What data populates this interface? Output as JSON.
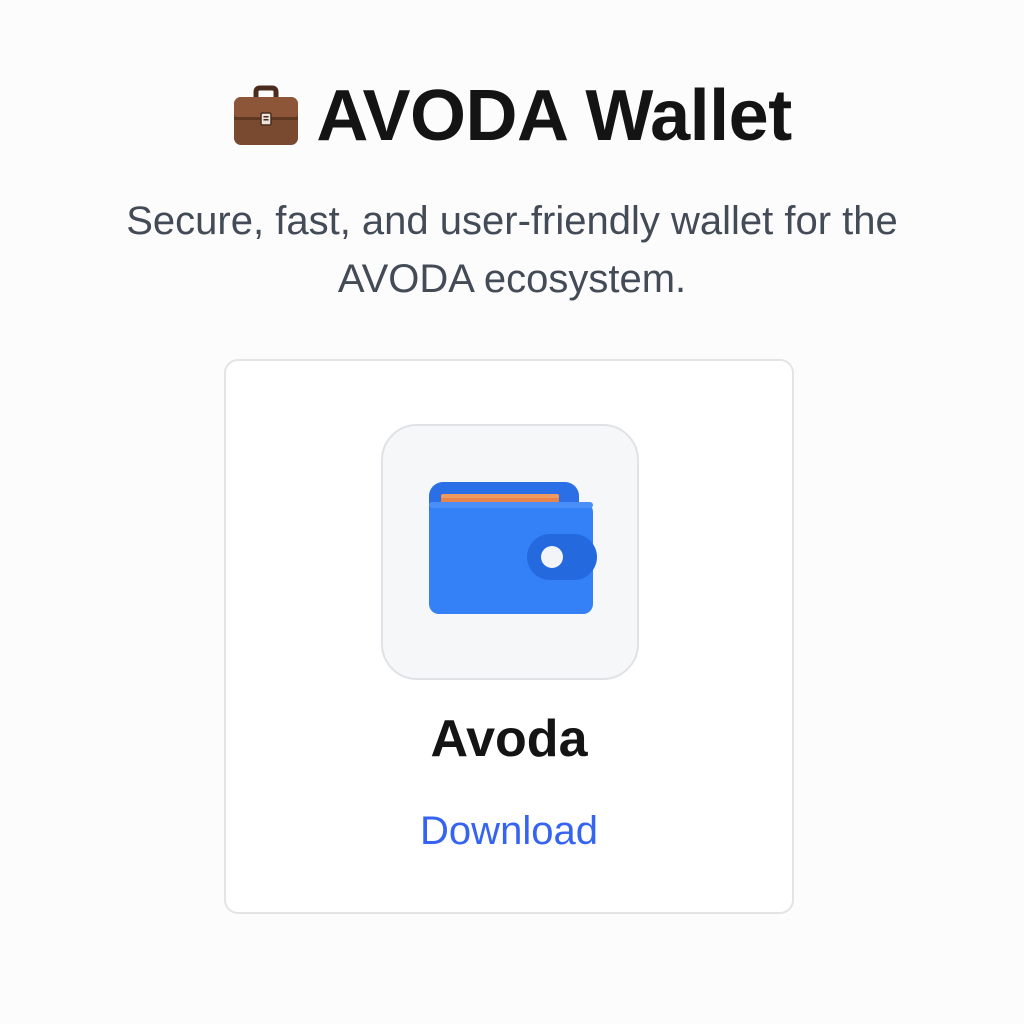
{
  "header": {
    "title": "AVODA Wallet",
    "title_icon": "briefcase-icon"
  },
  "subtitle": "Secure, fast, and user-friendly wallet for the AVODA ecosystem.",
  "card": {
    "app_icon": "wallet-icon",
    "app_name": "Avoda",
    "download_label": "Download"
  },
  "colors": {
    "background": "#fcfcfd",
    "title_text": "#141414",
    "subtitle_text": "#434b57",
    "link": "#3563f2",
    "wallet_blue": "#2f7bf5",
    "card_orange": "#e8854a"
  }
}
